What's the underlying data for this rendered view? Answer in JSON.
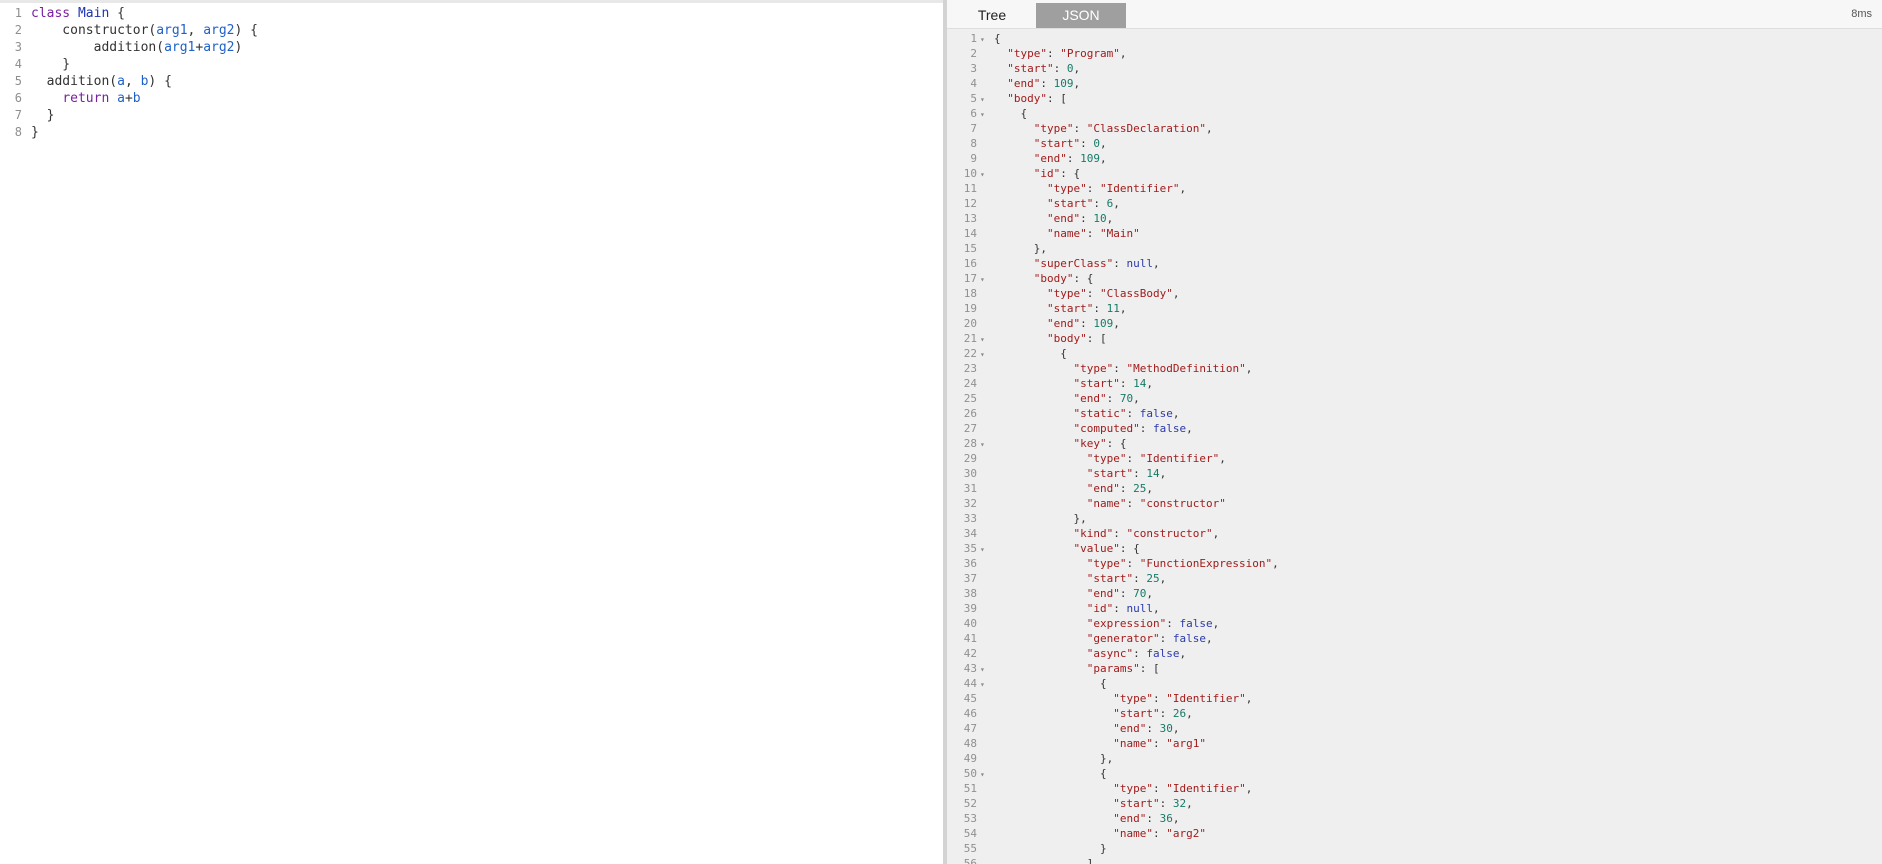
{
  "editor": {
    "lines": [
      {
        "n": "1",
        "tokens": [
          {
            "t": "class",
            "c": "kw"
          },
          {
            "t": " "
          },
          {
            "t": "Main",
            "c": "def"
          },
          {
            "t": " {"
          }
        ]
      },
      {
        "n": "2",
        "tokens": [
          {
            "t": "    constructor"
          },
          {
            "t": "("
          },
          {
            "t": "arg1",
            "c": "var"
          },
          {
            "t": ", "
          },
          {
            "t": "arg2",
            "c": "var"
          },
          {
            "t": ") {"
          }
        ]
      },
      {
        "n": "3",
        "tokens": [
          {
            "t": "        addition"
          },
          {
            "t": "("
          },
          {
            "t": "arg1",
            "c": "var"
          },
          {
            "t": "+"
          },
          {
            "t": "arg2",
            "c": "var"
          },
          {
            "t": ")"
          }
        ]
      },
      {
        "n": "4",
        "tokens": [
          {
            "t": "    }"
          }
        ]
      },
      {
        "n": "5",
        "tokens": [
          {
            "t": "  addition"
          },
          {
            "t": "("
          },
          {
            "t": "a",
            "c": "var"
          },
          {
            "t": ", "
          },
          {
            "t": "b",
            "c": "var"
          },
          {
            "t": ") {"
          }
        ]
      },
      {
        "n": "6",
        "tokens": [
          {
            "t": "    "
          },
          {
            "t": "return",
            "c": "kw"
          },
          {
            "t": " "
          },
          {
            "t": "a",
            "c": "var"
          },
          {
            "t": "+"
          },
          {
            "t": "b",
            "c": "var"
          }
        ]
      },
      {
        "n": "7",
        "tokens": [
          {
            "t": "  }"
          }
        ]
      },
      {
        "n": "8",
        "tokens": [
          {
            "t": "}"
          }
        ]
      }
    ]
  },
  "output": {
    "tabs": [
      {
        "label": "Tree",
        "active": false
      },
      {
        "label": "JSON",
        "active": true
      }
    ],
    "timing": "8ms",
    "json_lines": [
      {
        "n": "1",
        "fold": true,
        "text": "{"
      },
      {
        "n": "2",
        "text": "  \"type\": \"Program\","
      },
      {
        "n": "3",
        "text": "  \"start\": 0,"
      },
      {
        "n": "4",
        "text": "  \"end\": 109,"
      },
      {
        "n": "5",
        "fold": true,
        "text": "  \"body\": ["
      },
      {
        "n": "6",
        "fold": true,
        "text": "    {"
      },
      {
        "n": "7",
        "text": "      \"type\": \"ClassDeclaration\","
      },
      {
        "n": "8",
        "text": "      \"start\": 0,"
      },
      {
        "n": "9",
        "text": "      \"end\": 109,"
      },
      {
        "n": "10",
        "fold": true,
        "text": "      \"id\": {"
      },
      {
        "n": "11",
        "text": "        \"type\": \"Identifier\","
      },
      {
        "n": "12",
        "text": "        \"start\": 6,"
      },
      {
        "n": "13",
        "text": "        \"end\": 10,"
      },
      {
        "n": "14",
        "text": "        \"name\": \"Main\""
      },
      {
        "n": "15",
        "text": "      },"
      },
      {
        "n": "16",
        "text": "      \"superClass\": null,"
      },
      {
        "n": "17",
        "fold": true,
        "text": "      \"body\": {"
      },
      {
        "n": "18",
        "text": "        \"type\": \"ClassBody\","
      },
      {
        "n": "19",
        "text": "        \"start\": 11,"
      },
      {
        "n": "20",
        "text": "        \"end\": 109,"
      },
      {
        "n": "21",
        "fold": true,
        "text": "        \"body\": ["
      },
      {
        "n": "22",
        "fold": true,
        "text": "          {"
      },
      {
        "n": "23",
        "text": "            \"type\": \"MethodDefinition\","
      },
      {
        "n": "24",
        "text": "            \"start\": 14,"
      },
      {
        "n": "25",
        "text": "            \"end\": 70,"
      },
      {
        "n": "26",
        "text": "            \"static\": false,"
      },
      {
        "n": "27",
        "text": "            \"computed\": false,"
      },
      {
        "n": "28",
        "fold": true,
        "text": "            \"key\": {"
      },
      {
        "n": "29",
        "text": "              \"type\": \"Identifier\","
      },
      {
        "n": "30",
        "text": "              \"start\": 14,"
      },
      {
        "n": "31",
        "text": "              \"end\": 25,"
      },
      {
        "n": "32",
        "text": "              \"name\": \"constructor\""
      },
      {
        "n": "33",
        "text": "            },"
      },
      {
        "n": "34",
        "text": "            \"kind\": \"constructor\","
      },
      {
        "n": "35",
        "fold": true,
        "text": "            \"value\": {"
      },
      {
        "n": "36",
        "text": "              \"type\": \"FunctionExpression\","
      },
      {
        "n": "37",
        "text": "              \"start\": 25,"
      },
      {
        "n": "38",
        "text": "              \"end\": 70,"
      },
      {
        "n": "39",
        "text": "              \"id\": null,"
      },
      {
        "n": "40",
        "text": "              \"expression\": false,"
      },
      {
        "n": "41",
        "text": "              \"generator\": false,"
      },
      {
        "n": "42",
        "text": "              \"async\": false,"
      },
      {
        "n": "43",
        "fold": true,
        "text": "              \"params\": ["
      },
      {
        "n": "44",
        "fold": true,
        "text": "                {"
      },
      {
        "n": "45",
        "text": "                  \"type\": \"Identifier\","
      },
      {
        "n": "46",
        "text": "                  \"start\": 26,"
      },
      {
        "n": "47",
        "text": "                  \"end\": 30,"
      },
      {
        "n": "48",
        "text": "                  \"name\": \"arg1\""
      },
      {
        "n": "49",
        "text": "                },"
      },
      {
        "n": "50",
        "fold": true,
        "text": "                {"
      },
      {
        "n": "51",
        "text": "                  \"type\": \"Identifier\","
      },
      {
        "n": "52",
        "text": "                  \"start\": 32,"
      },
      {
        "n": "53",
        "text": "                  \"end\": 36,"
      },
      {
        "n": "54",
        "text": "                  \"name\": \"arg2\""
      },
      {
        "n": "55",
        "text": "                }"
      },
      {
        "n": "56",
        "text": "              ]"
      }
    ]
  }
}
